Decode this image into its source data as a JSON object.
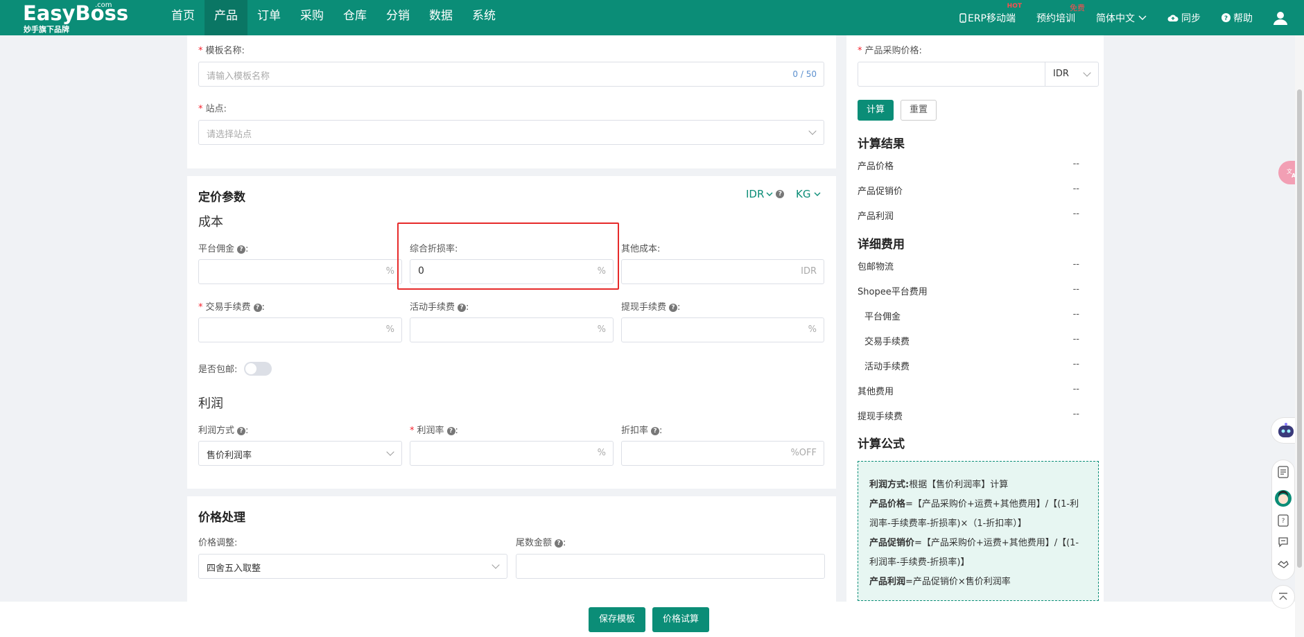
{
  "topbar": {
    "brand": "EasyBoss",
    "dotcom": ".com",
    "subbrand": "妙手旗下品牌",
    "nav": [
      "首页",
      "产品",
      "订单",
      "采购",
      "仓库",
      "分销",
      "数据",
      "系统"
    ],
    "active_nav": "产品",
    "right": {
      "erp": "ERP移动端",
      "hot": "HOT",
      "training": "预约培训",
      "free": "免费",
      "language": "简体中文",
      "sync": "同步",
      "help": "帮助"
    }
  },
  "template": {
    "name_label": "模板名称:",
    "name_placeholder": "请输入模板名称",
    "name_counter": "0 / 50",
    "site_label": "站点:",
    "site_placeholder": "请选择站点"
  },
  "pricing": {
    "title": "定价参数",
    "currency": "IDR",
    "weight_unit": "KG",
    "cost_title": "成本",
    "platform_commission": {
      "label": "平台佣金",
      "suffix": "%"
    },
    "discount_loss_rate": {
      "label": "综合折损率:",
      "value": "0",
      "suffix": "%"
    },
    "other_cost": {
      "label": "其他成本:",
      "suffix": "IDR"
    },
    "transaction_fee": {
      "label": "交易手续费",
      "suffix": "%"
    },
    "activity_fee": {
      "label": "活动手续费",
      "suffix": "%"
    },
    "withdraw_fee": {
      "label": "提现手续费",
      "suffix": "%"
    },
    "free_shipping_label": "是否包邮:",
    "profit_title": "利润",
    "profit_method": {
      "label": "利润方式",
      "value": "售价利润率"
    },
    "profit_rate": {
      "label": "利润率",
      "suffix": "%"
    },
    "discount_rate": {
      "label": "折扣率",
      "suffix": "%OFF"
    }
  },
  "price_processing": {
    "title": "价格处理",
    "adjust_label": "价格调整:",
    "adjust_value": "四舍五入取整",
    "tail_label": "尾数金额"
  },
  "calculator": {
    "purchase_price_label": "产品采购价格:",
    "currency": "IDR",
    "calc_button": "计算",
    "reset_button": "重置",
    "result_title": "计算结果",
    "results": [
      {
        "label": "产品价格",
        "value": "--"
      },
      {
        "label": "产品促销价",
        "value": "--"
      },
      {
        "label": "产品利润",
        "value": "--"
      }
    ],
    "detail_title": "详细费用",
    "details": [
      {
        "label": "包邮物流",
        "value": "--",
        "indent": false
      },
      {
        "label": "Shopee平台费用",
        "value": "--",
        "indent": false
      },
      {
        "label": "平台佣金",
        "value": "--",
        "indent": true
      },
      {
        "label": "交易手续费",
        "value": "--",
        "indent": true
      },
      {
        "label": "活动手续费",
        "value": "--",
        "indent": true
      },
      {
        "label": "其他费用",
        "value": "--",
        "indent": false
      },
      {
        "label": "提现手续费",
        "value": "--",
        "indent": false
      }
    ],
    "formula_title": "计算公式",
    "formula": {
      "method_key": "利润方式:",
      "method_val": "根据【售价利润率】计算",
      "price_key": "产品价格",
      "price_val": "=【产品采购价+运费+其他费用】/【(1-利润率-手续费率-折损率)×（1-折扣率）】",
      "promo_key": "产品促销价",
      "promo_val": "=【产品采购价+运费+其他费用】/【(1-利润率-手续费-折损率)】",
      "profit_key": "产品利润",
      "profit_val": "=产品促销价×售价利润率"
    }
  },
  "footer": {
    "save_template": "保存模板",
    "price_trial": "价格试算"
  },
  "colors": {
    "brand": "#0b8d77",
    "highlight": "#e62a2a",
    "required": "#f5222d"
  }
}
